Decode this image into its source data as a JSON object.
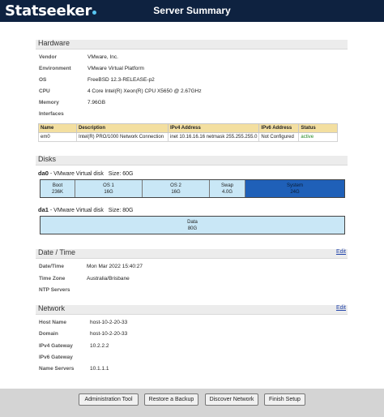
{
  "header": {
    "logo": "Statseeker",
    "title": "Server Summary"
  },
  "hardware": {
    "title": "Hardware",
    "rows": [
      {
        "key": "Vendor",
        "value": "VMware, Inc."
      },
      {
        "key": "Environment",
        "value": "VMware Virtual Platform"
      },
      {
        "key": "OS",
        "value": "FreeBSD 12.3-RELEASE-p2"
      },
      {
        "key": "CPU",
        "value": "4 Core Intel(R) Xeon(R) CPU X5650 @ 2.67GHz"
      },
      {
        "key": "Memory",
        "value": "7.96GB"
      },
      {
        "key": "Interfaces",
        "value": ""
      }
    ],
    "interfaces": {
      "columns": [
        "Name",
        "Description",
        "IPv4 Address",
        "IPv6 Address",
        "Status"
      ],
      "rows": [
        [
          "em0",
          "Intel(R) PRO/1000 Network Connection",
          "inet 10.16.16.16 netmask 255.255.255.0",
          "Not Configured",
          "active"
        ]
      ]
    }
  },
  "disks": {
    "title": "Disks",
    "items": [
      {
        "name": "da0",
        "desc": " - VMware Virtual disk",
        "size": "Size: 60G",
        "partitions": [
          {
            "name": "Boot",
            "size": "236K"
          },
          {
            "name": "OS 1",
            "size": "16G"
          },
          {
            "name": "OS 2",
            "size": "16G"
          },
          {
            "name": "Swap",
            "size": "4.0G"
          },
          {
            "name": "System",
            "size": "24G"
          }
        ]
      },
      {
        "name": "da1",
        "desc": " - VMware Virtual disk",
        "size": "Size: 80G",
        "partitions": [
          {
            "name": "Data",
            "size": "80G"
          }
        ]
      }
    ]
  },
  "datetime": {
    "title": "Date / Time",
    "edit": "Edit",
    "rows": [
      {
        "key": "Date/Time",
        "value": "Mon Mar 2022 15:40:27"
      },
      {
        "key": "Time Zone",
        "value": "Australia/Brisbane"
      },
      {
        "key": "NTP Servers",
        "value": ""
      }
    ]
  },
  "network": {
    "title": "Network",
    "edit": "Edit",
    "rows": [
      {
        "key": "Host Name",
        "value": "host-10-2-20-33"
      },
      {
        "key": "Domain",
        "value": "host-10-2-20-33"
      },
      {
        "key": "IPv4 Gateway",
        "value": "10.2.2.2"
      },
      {
        "key": "IPv6 Gateway",
        "value": ""
      },
      {
        "key": "Name Servers",
        "value": "10.1.1.1"
      }
    ]
  },
  "footer": {
    "buttons": [
      "Administration Tool",
      "Restore a Backup",
      "Discover Network",
      "Finish Setup"
    ]
  }
}
